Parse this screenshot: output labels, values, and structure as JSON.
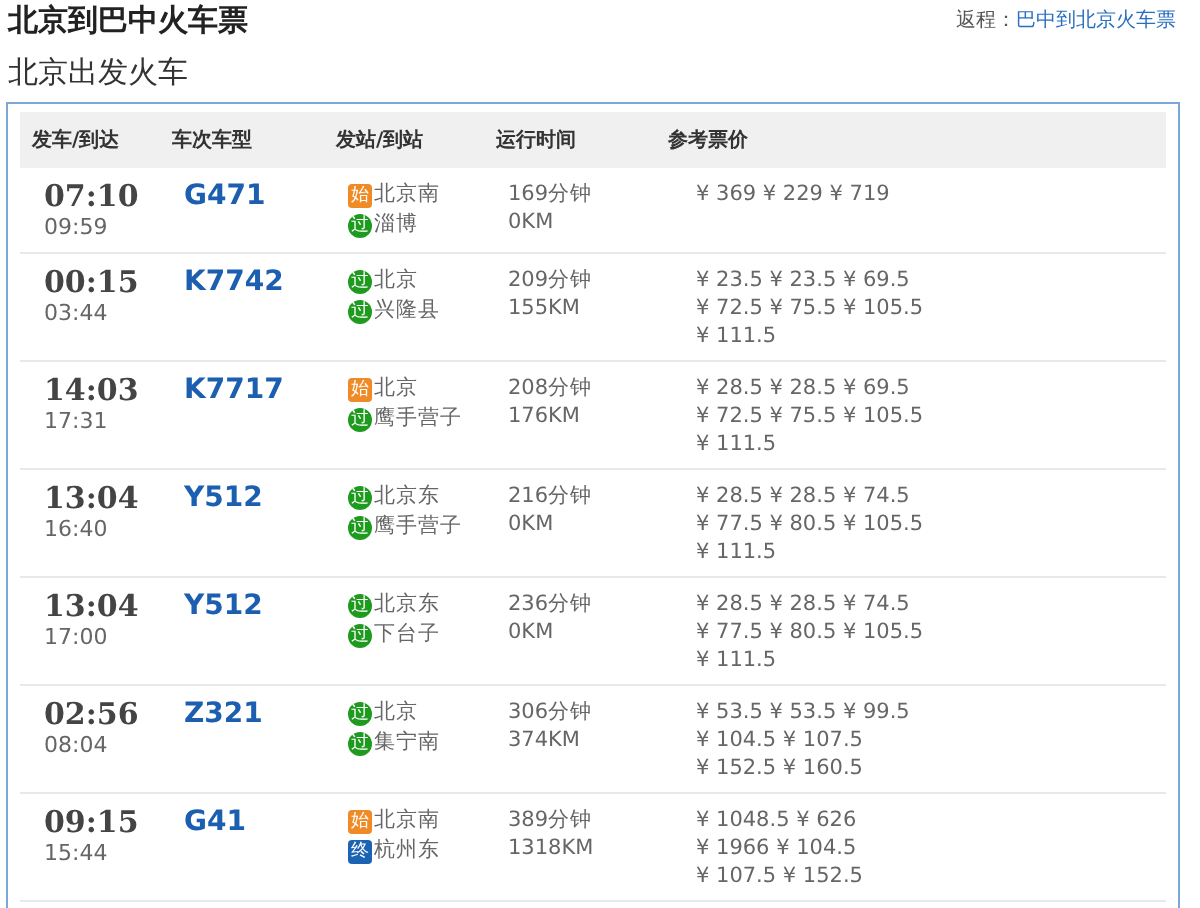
{
  "page_title": "北京到巴中火车票",
  "return_trip": {
    "label": "返程：",
    "link": "巴中到北京火车票"
  },
  "section_title": "北京出发火车",
  "table": {
    "columns": [
      "发车/到达",
      "车次车型",
      "发站/到站",
      "运行时间",
      "参考票价"
    ],
    "rows": [
      {
        "depart": "07:10",
        "arrive": "09:59",
        "train": "G471",
        "stations": [
          {
            "kind": "start",
            "badge": "始",
            "name": "北京南"
          },
          {
            "kind": "pass",
            "badge": "过",
            "name": "淄博"
          }
        ],
        "duration": "169分钟",
        "distance": "0KM",
        "prices": [
          "¥ 369 ¥ 229 ¥ 719"
        ]
      },
      {
        "depart": "00:15",
        "arrive": "03:44",
        "train": "K7742",
        "stations": [
          {
            "kind": "pass",
            "badge": "过",
            "name": "北京"
          },
          {
            "kind": "pass",
            "badge": "过",
            "name": "兴隆县"
          }
        ],
        "duration": "209分钟",
        "distance": "155KM",
        "prices": [
          "¥ 23.5 ¥ 23.5 ¥ 69.5",
          "¥ 72.5 ¥ 75.5 ¥ 105.5",
          "¥ 111.5"
        ]
      },
      {
        "depart": "14:03",
        "arrive": "17:31",
        "train": "K7717",
        "stations": [
          {
            "kind": "start",
            "badge": "始",
            "name": "北京"
          },
          {
            "kind": "pass",
            "badge": "过",
            "name": "鹰手营子"
          }
        ],
        "duration": "208分钟",
        "distance": "176KM",
        "prices": [
          "¥ 28.5 ¥ 28.5 ¥ 69.5",
          "¥ 72.5 ¥ 75.5 ¥ 105.5",
          "¥ 111.5"
        ]
      },
      {
        "depart": "13:04",
        "arrive": "16:40",
        "train": "Y512",
        "stations": [
          {
            "kind": "pass",
            "badge": "过",
            "name": "北京东"
          },
          {
            "kind": "pass",
            "badge": "过",
            "name": "鹰手营子"
          }
        ],
        "duration": "216分钟",
        "distance": "0KM",
        "prices": [
          "¥ 28.5 ¥ 28.5 ¥ 74.5",
          "¥ 77.5 ¥ 80.5 ¥ 105.5",
          "¥ 111.5"
        ]
      },
      {
        "depart": "13:04",
        "arrive": "17:00",
        "train": "Y512",
        "stations": [
          {
            "kind": "pass",
            "badge": "过",
            "name": "北京东"
          },
          {
            "kind": "pass",
            "badge": "过",
            "name": "下台子"
          }
        ],
        "duration": "236分钟",
        "distance": "0KM",
        "prices": [
          "¥ 28.5 ¥ 28.5 ¥ 74.5",
          "¥ 77.5 ¥ 80.5 ¥ 105.5",
          "¥ 111.5"
        ]
      },
      {
        "depart": "02:56",
        "arrive": "08:04",
        "train": "Z321",
        "stations": [
          {
            "kind": "pass",
            "badge": "过",
            "name": "北京"
          },
          {
            "kind": "pass",
            "badge": "过",
            "name": "集宁南"
          }
        ],
        "duration": "306分钟",
        "distance": "374KM",
        "prices": [
          "¥ 53.5 ¥ 53.5 ¥ 99.5",
          "¥ 104.5 ¥ 107.5",
          "¥ 152.5 ¥ 160.5"
        ]
      },
      {
        "depart": "09:15",
        "arrive": "15:44",
        "train": "G41",
        "stations": [
          {
            "kind": "start",
            "badge": "始",
            "name": "北京南"
          },
          {
            "kind": "end",
            "badge": "终",
            "name": "杭州东"
          }
        ],
        "duration": "389分钟",
        "distance": "1318KM",
        "prices": [
          "¥ 1048.5 ¥ 626",
          "¥ 1966 ¥ 104.5",
          "¥ 107.5 ¥ 152.5"
        ]
      }
    ]
  }
}
